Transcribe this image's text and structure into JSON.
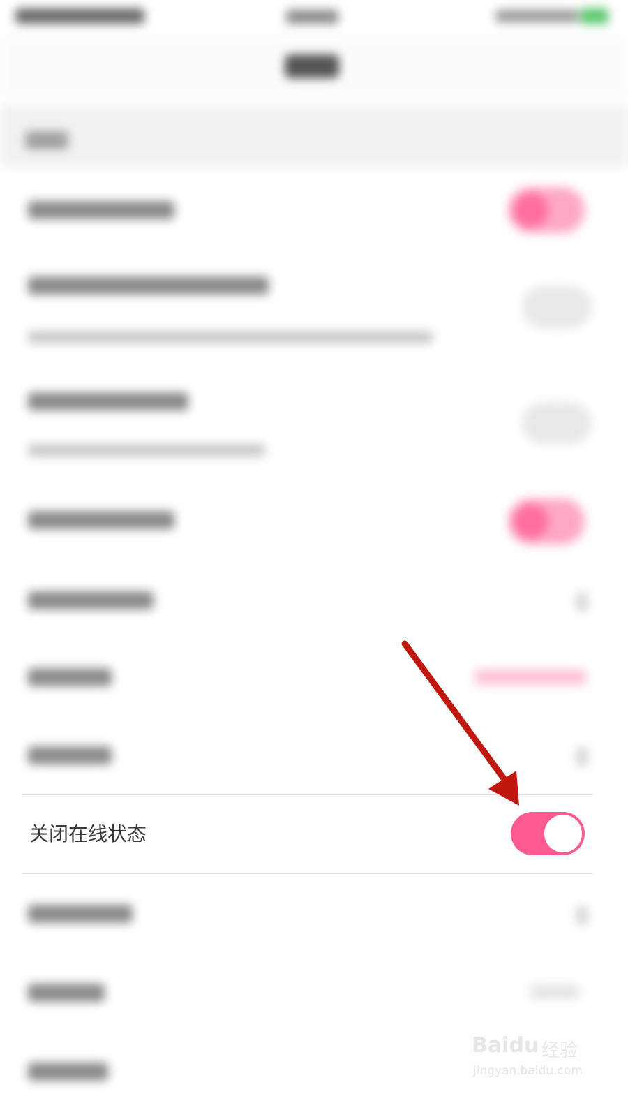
{
  "setting_row": {
    "label": "关闭在线状态",
    "toggle_on": true
  },
  "colors": {
    "toggle_on": "#ff5a8f",
    "annotation_arrow": "#c0180e"
  },
  "watermark": {
    "brand": "Baidu",
    "product": "经验",
    "url": "jingyan.baidu.com"
  }
}
